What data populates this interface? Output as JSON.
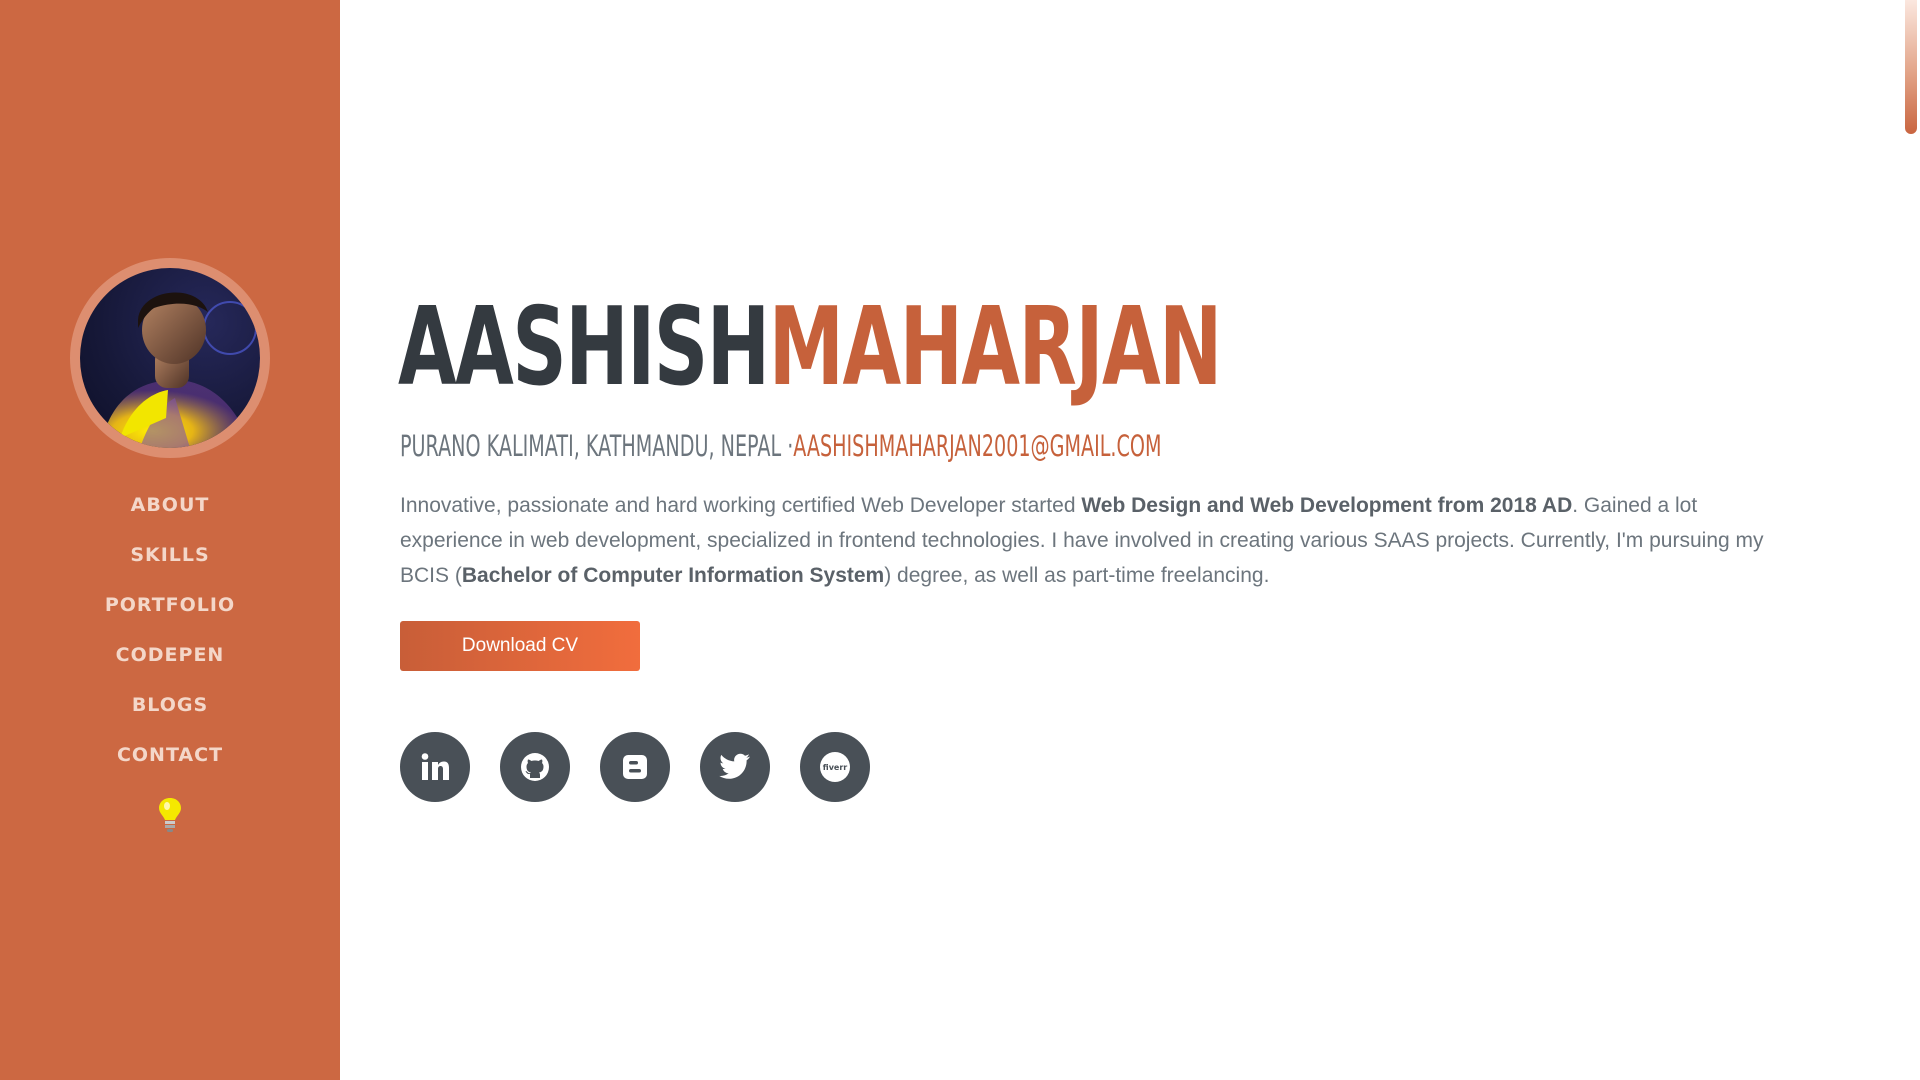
{
  "profile": {
    "first_name": "AASHISH",
    "last_name": "MAHARJAN",
    "address": "PURANO KALIMATI, KATHMANDU, NEPAL ·",
    "email": "AASHISHMAHARJAN2001@GMAIL.COM",
    "bio": {
      "part1": "Innovative, passionate and hard working certified Web Developer started ",
      "bold1": "Web Design and Web Development from 2018 AD",
      "part2": ". Gained a lot experience in web development, specialized in frontend technologies. I have involved in creating various SAAS projects. Currently, I'm pursuing my BCIS (",
      "bold2": "Bachelor of Computer Information System",
      "part3": ") degree, as well as part-time freelancing."
    },
    "download_button": "Download CV"
  },
  "nav": {
    "items": [
      {
        "label": "ABOUT"
      },
      {
        "label": "SKILLS"
      },
      {
        "label": "PORTFOLIO"
      },
      {
        "label": "CODEPEN"
      },
      {
        "label": "BLOGS"
      },
      {
        "label": "CONTACT"
      }
    ],
    "theme_toggle_icon": "lightbulb-icon"
  },
  "socials": [
    {
      "icon": "linkedin-icon"
    },
    {
      "icon": "github-icon"
    },
    {
      "icon": "blogger-icon"
    },
    {
      "icon": "twitter-icon"
    },
    {
      "icon": "fiverr-icon",
      "text": "fiverr"
    }
  ],
  "colors": {
    "sidebar": "#cc6842",
    "accent": "#c6613b",
    "heading_dark": "#343a40",
    "social_bg": "#495057"
  }
}
